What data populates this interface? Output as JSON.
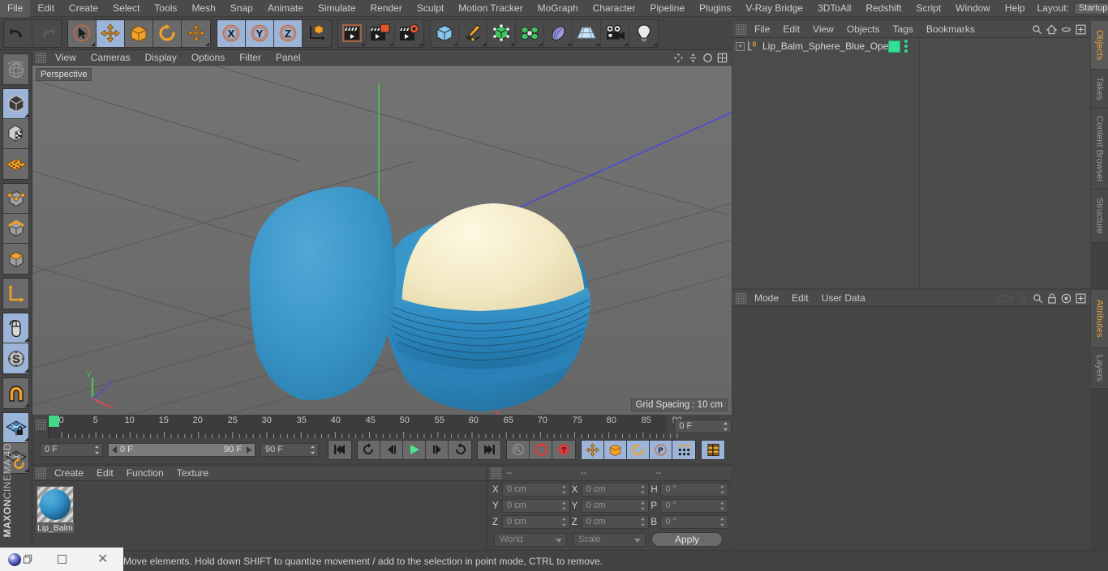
{
  "menubar": {
    "items": [
      "File",
      "Edit",
      "Create",
      "Select",
      "Tools",
      "Mesh",
      "Snap",
      "Animate",
      "Simulate",
      "Render",
      "Sculpt",
      "Motion Tracker",
      "MoGraph",
      "Character",
      "Pipeline",
      "Plugins",
      "V-Ray Bridge",
      "3DToAll",
      "Redshift",
      "Script",
      "Window",
      "Help"
    ],
    "layout_label": "Layout:",
    "layout_value": "Startup"
  },
  "toolbar": {
    "groups": [
      {
        "name": "undo-redo",
        "buttons": [
          {
            "name": "undo-button",
            "icon": "undo-icon",
            "state": "dark"
          },
          {
            "name": "redo-button",
            "icon": "redo-icon",
            "state": "dark-disabled"
          }
        ]
      },
      {
        "name": "tools",
        "buttons": [
          {
            "name": "live-selection-tool",
            "icon": "cursor-circle-icon",
            "state": "normal"
          },
          {
            "name": "move-tool",
            "icon": "move-arrows-icon",
            "state": "active"
          },
          {
            "name": "scale-tool",
            "icon": "scale-box-icon",
            "state": "normal"
          },
          {
            "name": "rotate-tool",
            "icon": "rotate-icon",
            "state": "normal"
          },
          {
            "name": "transform-tool",
            "icon": "move-arrows-icon",
            "state": "normal"
          }
        ]
      },
      {
        "name": "axis-locks",
        "buttons": [
          {
            "name": "x-axis-lock",
            "icon": "x-axis-icon",
            "state": "active"
          },
          {
            "name": "y-axis-lock",
            "icon": "y-axis-icon",
            "state": "active"
          },
          {
            "name": "z-axis-lock",
            "icon": "z-axis-icon",
            "state": "active"
          },
          {
            "name": "world-object-coordinates",
            "icon": "world-axis-icon",
            "state": "normal"
          }
        ]
      },
      {
        "name": "render",
        "buttons": [
          {
            "name": "render-view-button",
            "icon": "clapper-icon",
            "state": "dark"
          },
          {
            "name": "render-to-picture-viewer-button",
            "icon": "clapper-window-icon",
            "state": "dark"
          },
          {
            "name": "render-settings-button",
            "icon": "clapper-gear-icon",
            "state": "dark"
          }
        ]
      },
      {
        "name": "create",
        "buttons": [
          {
            "name": "add-cube-button",
            "icon": "cube-blue-icon",
            "state": "dark"
          },
          {
            "name": "add-spline-button",
            "icon": "pen-spline-icon",
            "state": "dark"
          },
          {
            "name": "add-generator-button",
            "icon": "green-cube-icon",
            "state": "dark"
          },
          {
            "name": "add-mograph-button",
            "icon": "cloner-icon",
            "state": "dark"
          },
          {
            "name": "add-deformer-button",
            "icon": "bend-deformer-icon",
            "state": "dark"
          },
          {
            "name": "add-environment-button",
            "icon": "floor-grid-icon",
            "state": "dark"
          },
          {
            "name": "add-camera-button",
            "icon": "camera-icon",
            "state": "dark"
          },
          {
            "name": "add-light-button",
            "icon": "light-bulb-icon",
            "state": "dark"
          }
        ]
      }
    ]
  },
  "left_toolbar": {
    "groups": [
      {
        "buttons": [
          {
            "name": "undo-view-button",
            "icon": "globe-sphere-icon",
            "state": "dark"
          }
        ]
      },
      {
        "buttons": [
          {
            "name": "model-mode-button",
            "icon": "model-cube-icon",
            "state": "active"
          },
          {
            "name": "texture-mode-button",
            "icon": "texture-cube-icon",
            "state": "normal"
          },
          {
            "name": "workplane-mode-button",
            "icon": "workplane-icon",
            "state": "normal"
          }
        ]
      },
      {
        "buttons": [
          {
            "name": "point-mode-button",
            "icon": "point-cube-icon",
            "state": "normal"
          },
          {
            "name": "edge-mode-button",
            "icon": "edge-cube-icon",
            "state": "normal"
          },
          {
            "name": "polygon-mode-button",
            "icon": "polygon-cube-icon",
            "state": "normal"
          }
        ]
      },
      {
        "buttons": [
          {
            "name": "object-axis-button",
            "icon": "axis-corner-icon",
            "state": "normal"
          }
        ]
      },
      {
        "buttons": [
          {
            "name": "viewport-solo-button",
            "icon": "mouse-icon",
            "state": "active"
          },
          {
            "name": "soft-selection-button",
            "icon": "s-compass-icon",
            "state": "active"
          }
        ]
      },
      {
        "buttons": [
          {
            "name": "snap-magnet-button",
            "icon": "magnet-icon",
            "state": "normal"
          }
        ]
      },
      {
        "buttons": [
          {
            "name": "lock-workplane-button",
            "icon": "grid-lock-icon",
            "state": "active"
          },
          {
            "name": "planar-workplane-button",
            "icon": "grid-rotate-icon",
            "state": "normal"
          }
        ]
      }
    ],
    "brand_bold": "MAXON",
    "brand_light": "CINEMA 4D"
  },
  "viewport": {
    "menu": [
      "View",
      "Cameras",
      "Display",
      "Options",
      "Filter",
      "Panel"
    ],
    "label": "Perspective",
    "grid_spacing": "Grid Spacing : 10 cm",
    "axis_labels": {
      "x": "X",
      "y": "Y",
      "z": "Z"
    },
    "colors": {
      "background_top": "#6f6f6f",
      "background_bottom": "#696969",
      "lid_blue": "#3a96c9",
      "balm_cream": "#f0e7c0",
      "base_blue": "#2f8fc6",
      "axis_x": "#d84b4b",
      "axis_y": "#4fc44f",
      "axis_z": "#4a4ad8",
      "grid_line": "#575757"
    }
  },
  "timeline": {
    "ruler_labels": [
      "0",
      "5",
      "10",
      "15",
      "20",
      "25",
      "30",
      "35",
      "40",
      "45",
      "50",
      "55",
      "60",
      "65",
      "70",
      "75",
      "80",
      "85",
      "90"
    ],
    "current_frame_ruler": "0 F",
    "current_frame": "0 F",
    "range_start": "0 F",
    "range_end": "90 F",
    "end_frame": "90 F",
    "buttons": [
      {
        "name": "go-to-start-button",
        "icon": "skip-start-icon",
        "state": "dark"
      },
      {
        "name": "previous-key-button",
        "icon": "rewind-loop-icon",
        "state": "dark"
      },
      {
        "name": "previous-frame-button",
        "icon": "step-back-icon",
        "state": "dark"
      },
      {
        "name": "play-button",
        "icon": "play-icon",
        "state": "dark"
      },
      {
        "name": "next-frame-button",
        "icon": "step-forward-icon",
        "state": "dark"
      },
      {
        "name": "next-key-button",
        "icon": "forward-loop-icon",
        "state": "dark"
      },
      {
        "name": "go-to-end-button",
        "icon": "skip-end-icon",
        "state": "dark"
      },
      {
        "name": "record-active-objects-button",
        "icon": "key-icon",
        "state": "dark"
      },
      {
        "name": "autokeying-button",
        "icon": "red-circle-icon",
        "state": "dark"
      },
      {
        "name": "keyframe-selection-button",
        "icon": "red-question-icon",
        "state": "dark"
      },
      {
        "name": "position-key-button",
        "icon": "move-arrows-icon",
        "state": "active"
      },
      {
        "name": "scale-key-button",
        "icon": "scale-box-icon",
        "state": "active"
      },
      {
        "name": "rotation-key-button",
        "icon": "rotate-icon",
        "state": "active"
      },
      {
        "name": "param-key-button",
        "icon": "p-circle-icon",
        "state": "active"
      },
      {
        "name": "point-level-animation-button",
        "icon": "dot-matrix-icon",
        "state": "active"
      },
      {
        "name": "timeline-toggle-button",
        "icon": "film-strip-icon",
        "state": "active"
      }
    ]
  },
  "material_manager": {
    "menu": [
      "Create",
      "Edit",
      "Function",
      "Texture"
    ],
    "materials": [
      {
        "name": "Lip_Balm",
        "color": "#2f8fc6"
      }
    ]
  },
  "coordinates": {
    "headers": [
      "--",
      "--",
      "--"
    ],
    "rows": [
      {
        "pos_label": "X",
        "pos_value": "0 cm",
        "size_label": "X",
        "size_value": "0 cm",
        "rot_label": "H",
        "rot_value": "0 °"
      },
      {
        "pos_label": "Y",
        "pos_value": "0 cm",
        "size_label": "Y",
        "size_value": "0 cm",
        "rot_label": "P",
        "rot_value": "0 °"
      },
      {
        "pos_label": "Z",
        "pos_value": "0 cm",
        "size_label": "Z",
        "size_value": "0 cm",
        "rot_label": "B",
        "rot_value": "0 °"
      }
    ],
    "system_select": "World",
    "mode_select": "Scale",
    "apply_label": "Apply"
  },
  "object_manager": {
    "menu": [
      "File",
      "Edit",
      "View",
      "Objects",
      "Tags",
      "Bookmarks"
    ],
    "icons": [
      "search-icon",
      "home-icon",
      "ellipse-icon",
      "plus-box-icon"
    ],
    "rows": [
      {
        "name": "Lip_Balm_Sphere_Blue_Open",
        "level_badge": "0",
        "tag_color": "#33dd94"
      }
    ]
  },
  "attributes": {
    "menu": [
      "Mode",
      "Edit",
      "User Data"
    ],
    "icons": [
      "left-arrow-icon",
      "up-arrow-icon",
      "search-icon",
      "lock-icon",
      "target-icon",
      "plus-box-icon"
    ]
  },
  "right_tabs": {
    "upper": [
      "Objects",
      "Takes",
      "Content Browser",
      "Structure"
    ],
    "lower": [
      "Attributes",
      "Layers"
    ]
  },
  "status": {
    "message": "Move elements. Hold down SHIFT to quantize movement / add to the selection in point mode, CTRL to remove."
  },
  "taskbar": {
    "items": [
      "c4d-app-icon",
      "maximize-icon",
      "close-icon"
    ]
  }
}
